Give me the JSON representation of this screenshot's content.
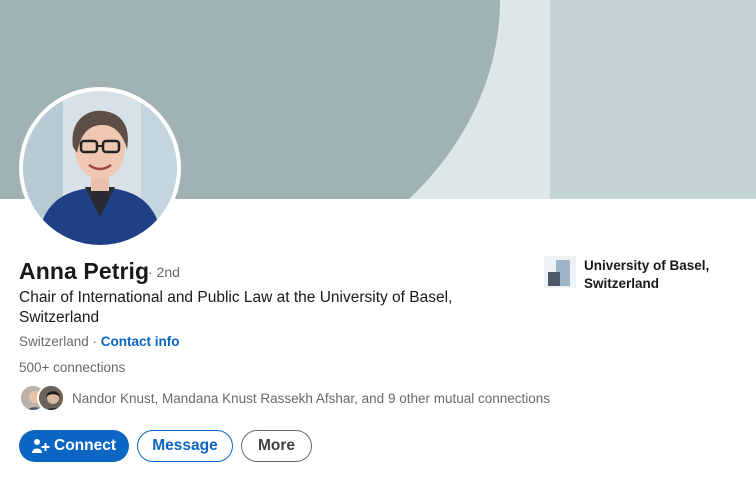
{
  "profile": {
    "name": "Anna Petrig",
    "degree": "· 2nd",
    "headline": "Chair of International and Public Law at the University of Basel, Switzerland",
    "location": "Switzerland",
    "location_sep": " · ",
    "contact_info": "Contact info",
    "connections": "500+ connections",
    "mutual": "Nandor Knust, Mandana Knust Rassekh Afshar, and 9 other mutual connections"
  },
  "organization": {
    "name": "University of Basel, Switzerland",
    "logo_icon": "university-logo"
  },
  "actions": {
    "connect": "Connect",
    "message": "Message",
    "more": "More"
  },
  "colors": {
    "accent": "#0a66c2",
    "cover_dark": "#a1b2b4",
    "cover_light": "#c3d3d6"
  }
}
